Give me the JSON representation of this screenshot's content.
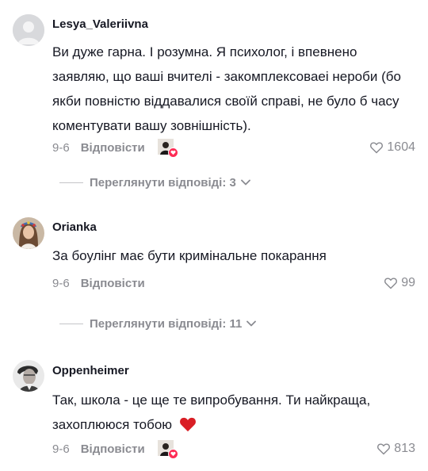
{
  "comments": [
    {
      "username": "Lesya_Valeriivna",
      "text": "Ви дуже гарна. І розумна. Я психолог, і впевнено заявляю, що ваші вчителі - закомплексоваеі нероби (бо якби повністю віддавалися своїй справі, не було б часу коментувати вашу зовнішність).",
      "date": "9-6",
      "reply_label": "Відповісти",
      "creator_liked": true,
      "likes": "1604",
      "view_replies": "Переглянути відповіді: 3"
    },
    {
      "username": "Orianka",
      "text": "За боулінг має бути кримінальне покарання",
      "date": "9-6",
      "reply_label": "Відповісти",
      "creator_liked": false,
      "likes": "99",
      "view_replies": "Переглянути відповіді: 11"
    },
    {
      "username": "Oppenheimer",
      "text": "Так, школа - це ще те випробування. Ти найкраща, захоплююся тобою",
      "emoji": "❤️",
      "date": "9-6",
      "reply_label": "Відповісти",
      "creator_liked": true,
      "likes": "813"
    }
  ],
  "colors": {
    "text": "#161823",
    "muted": "#8a8b91",
    "accent": "#fe2c55"
  }
}
